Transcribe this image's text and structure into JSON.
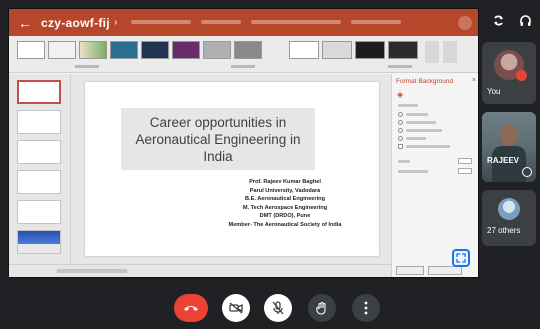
{
  "meeting": {
    "code": "czy-aowf-fij",
    "tiles": {
      "you_label": "You",
      "rajeev_label": "RAJEEV",
      "others_label": "27 others"
    }
  },
  "slide": {
    "title": "Career opportunities in Aeronautical Engineering in India",
    "credits": [
      "Prof. Rajeev Kumar Baghel",
      "Parul University, Vadodara",
      "B.E. Aeronautical Engineering",
      "M. Tech Aerospace Engineering",
      "DMT (DRDO), Pune",
      "Member- The Aeronautical Society of India"
    ]
  },
  "format_pane": {
    "title": "Format Background"
  },
  "icons": {
    "back": "arrow-left-icon",
    "chevron": "chevron-right-icon",
    "rotate": "rotate-icon",
    "headphones": "headphones-icon",
    "end_call": "end-call-icon",
    "camera_off": "camera-off-icon",
    "mic_off": "mic-off-icon",
    "hand": "raise-hand-icon",
    "more": "more-vert-icon",
    "fit": "fit-screen-icon"
  },
  "colors": {
    "ppt_accent": "#b7472a",
    "end_call": "#ea4335",
    "background": "#202124"
  }
}
